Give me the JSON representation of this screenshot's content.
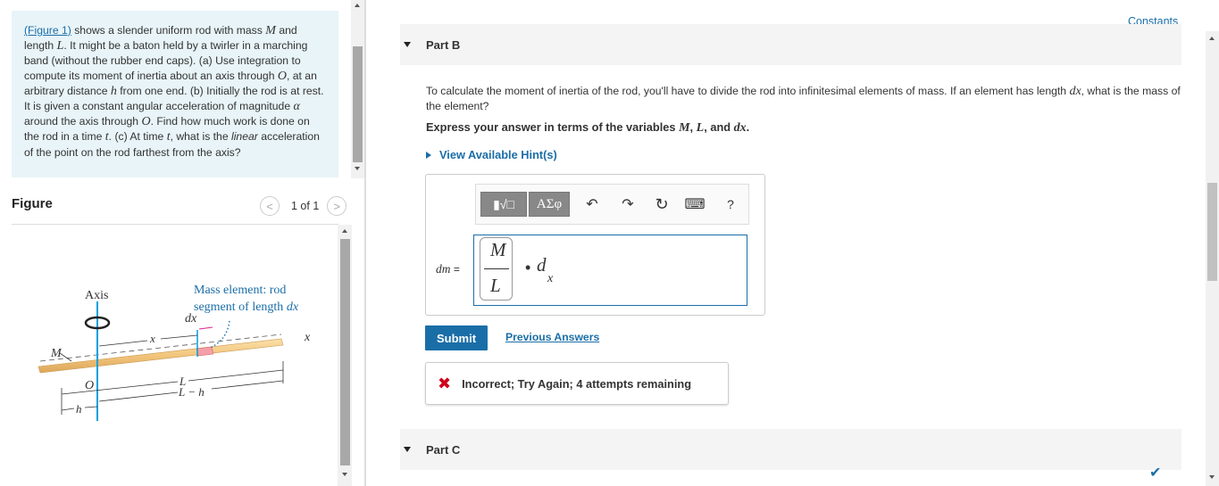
{
  "problem": {
    "figure_link": "(Figure 1)",
    "t1": " shows a slender uniform rod with mass ",
    "M": "M",
    "t2": " and length ",
    "L": "L",
    "t3": ". It might be a baton held by a twirler in a marching band (without the rubber end caps). (a) Use integration to compute its moment of inertia about an axis through ",
    "O": "O",
    "t4": ", at an arbitrary distance ",
    "h": "h",
    "t5": " from one end. (b) Initially the rod is at rest. It is given a constant angular acceleration of magnitude ",
    "alpha": "α",
    "t6": " around the axis through ",
    "O2": "O",
    "t7": ". Find how much work is done on the rod in a time ",
    "t": "t",
    "t8": ". (c) At time ",
    "t_2": "t",
    "t9": ", what is the ",
    "linear": "linear",
    "t10": " acceleration of the point on the rod farthest from the axis?"
  },
  "figure": {
    "title": "Figure",
    "page": "1 of 1",
    "prev_icon": "<",
    "next_icon": ">",
    "labels": {
      "axis": "Axis",
      "mass_element_1": "Mass element: rod",
      "mass_element_2": "segment of length ",
      "dx": "dx",
      "dx_top": "dx",
      "x_mid": "x",
      "x_end": "x",
      "M": "M",
      "O": "O",
      "L": "L",
      "L_minus_h": "L − h",
      "h": "h"
    }
  },
  "constants_link": "Constants",
  "partB": {
    "label": "Part B",
    "question_a": "To calculate the moment of inertia of the rod, you'll have to divide the rod into infinitesimal elements of mass. If an element has length ",
    "question_var": "dx",
    "question_b": ", what is the mass of the element?",
    "express_a": "Express your answer in terms of the variables ",
    "express_M": "M",
    "express_sep1": ", ",
    "express_L": "L",
    "express_sep2": ", and ",
    "express_dx": "dx",
    "express_end": ".",
    "hint": "View Available Hint(s)",
    "toolbar": {
      "template_label": "▮√□",
      "greek_label": "ΑΣφ",
      "undo": "↶",
      "redo": "↷",
      "reset": "↻",
      "keyboard": "⌨",
      "help": "?"
    },
    "answer_label": "dm",
    "answer_eq": " =",
    "answer": {
      "numerator": "M",
      "denominator": "L",
      "dot": "•",
      "d": "d",
      "sub": "x"
    },
    "submit": "Submit",
    "previous_answers": "Previous Answers",
    "feedback_icon": "✖",
    "feedback": "Incorrect; Try Again; 4 attempts remaining"
  },
  "partC": {
    "label": "Part C",
    "status_icon": "✔"
  },
  "colors": {
    "link": "#1a6ea8",
    "problem_bg": "#e8f4f8",
    "error": "#d0021b",
    "rod": "#f2c57c",
    "axis": "#00a0e0",
    "arrow_mark": "#e0218a"
  }
}
